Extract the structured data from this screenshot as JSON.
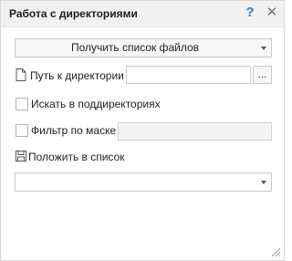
{
  "window": {
    "title": "Работа с директориями",
    "help_symbol": "?",
    "close_symbol": "✕"
  },
  "action_select": {
    "value": "Получить список файлов"
  },
  "directory": {
    "label": "Путь к директории",
    "value": "",
    "browse_label": "...",
    "icon": "file-icon"
  },
  "search_subdirs": {
    "label": "Искать в поддиректориях",
    "checked": false
  },
  "mask_filter": {
    "label": "Фильтр по маске",
    "checked": false,
    "value": ""
  },
  "output": {
    "label": "Положить в список",
    "icon": "save-icon",
    "value": ""
  },
  "colors": {
    "titlebar": "#f1f1f1",
    "help_icon": "#2e7fd0",
    "border": "#c8c8c8"
  }
}
